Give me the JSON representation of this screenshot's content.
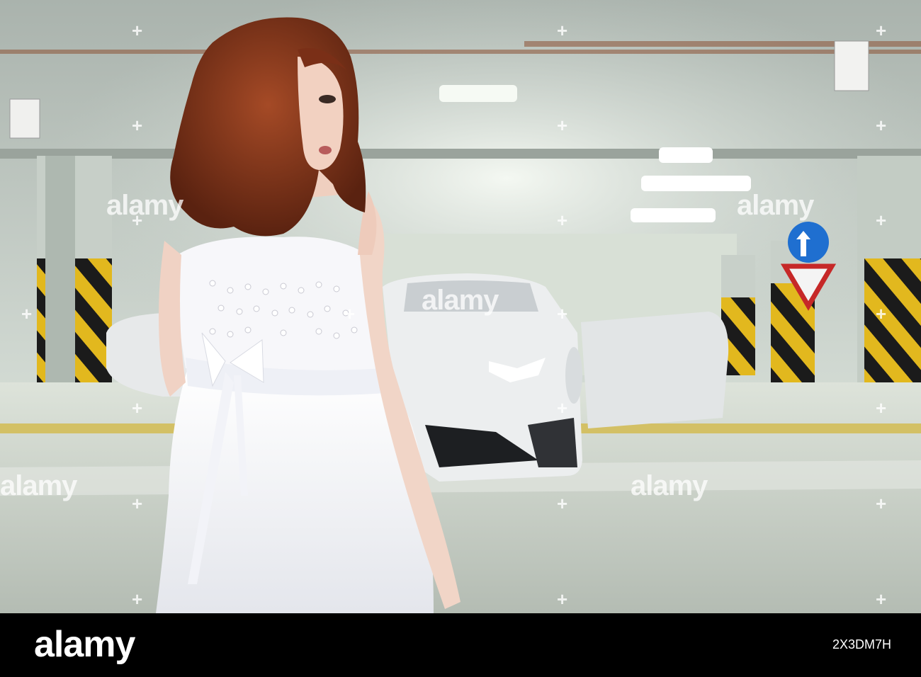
{
  "watermark": {
    "text": "alamy",
    "plus": "+"
  },
  "footer": {
    "brand": "alamy",
    "image_id": "2X3DM7H"
  },
  "colors": {
    "hair": "#8a3a1c",
    "dress": "#f4f4f8",
    "car": "#e8eaeb",
    "floor": "#c9d0c8",
    "hazard_yellow": "#e8c020",
    "hazard_black": "#1a1a1a",
    "sign_blue": "#1f6fd0"
  }
}
